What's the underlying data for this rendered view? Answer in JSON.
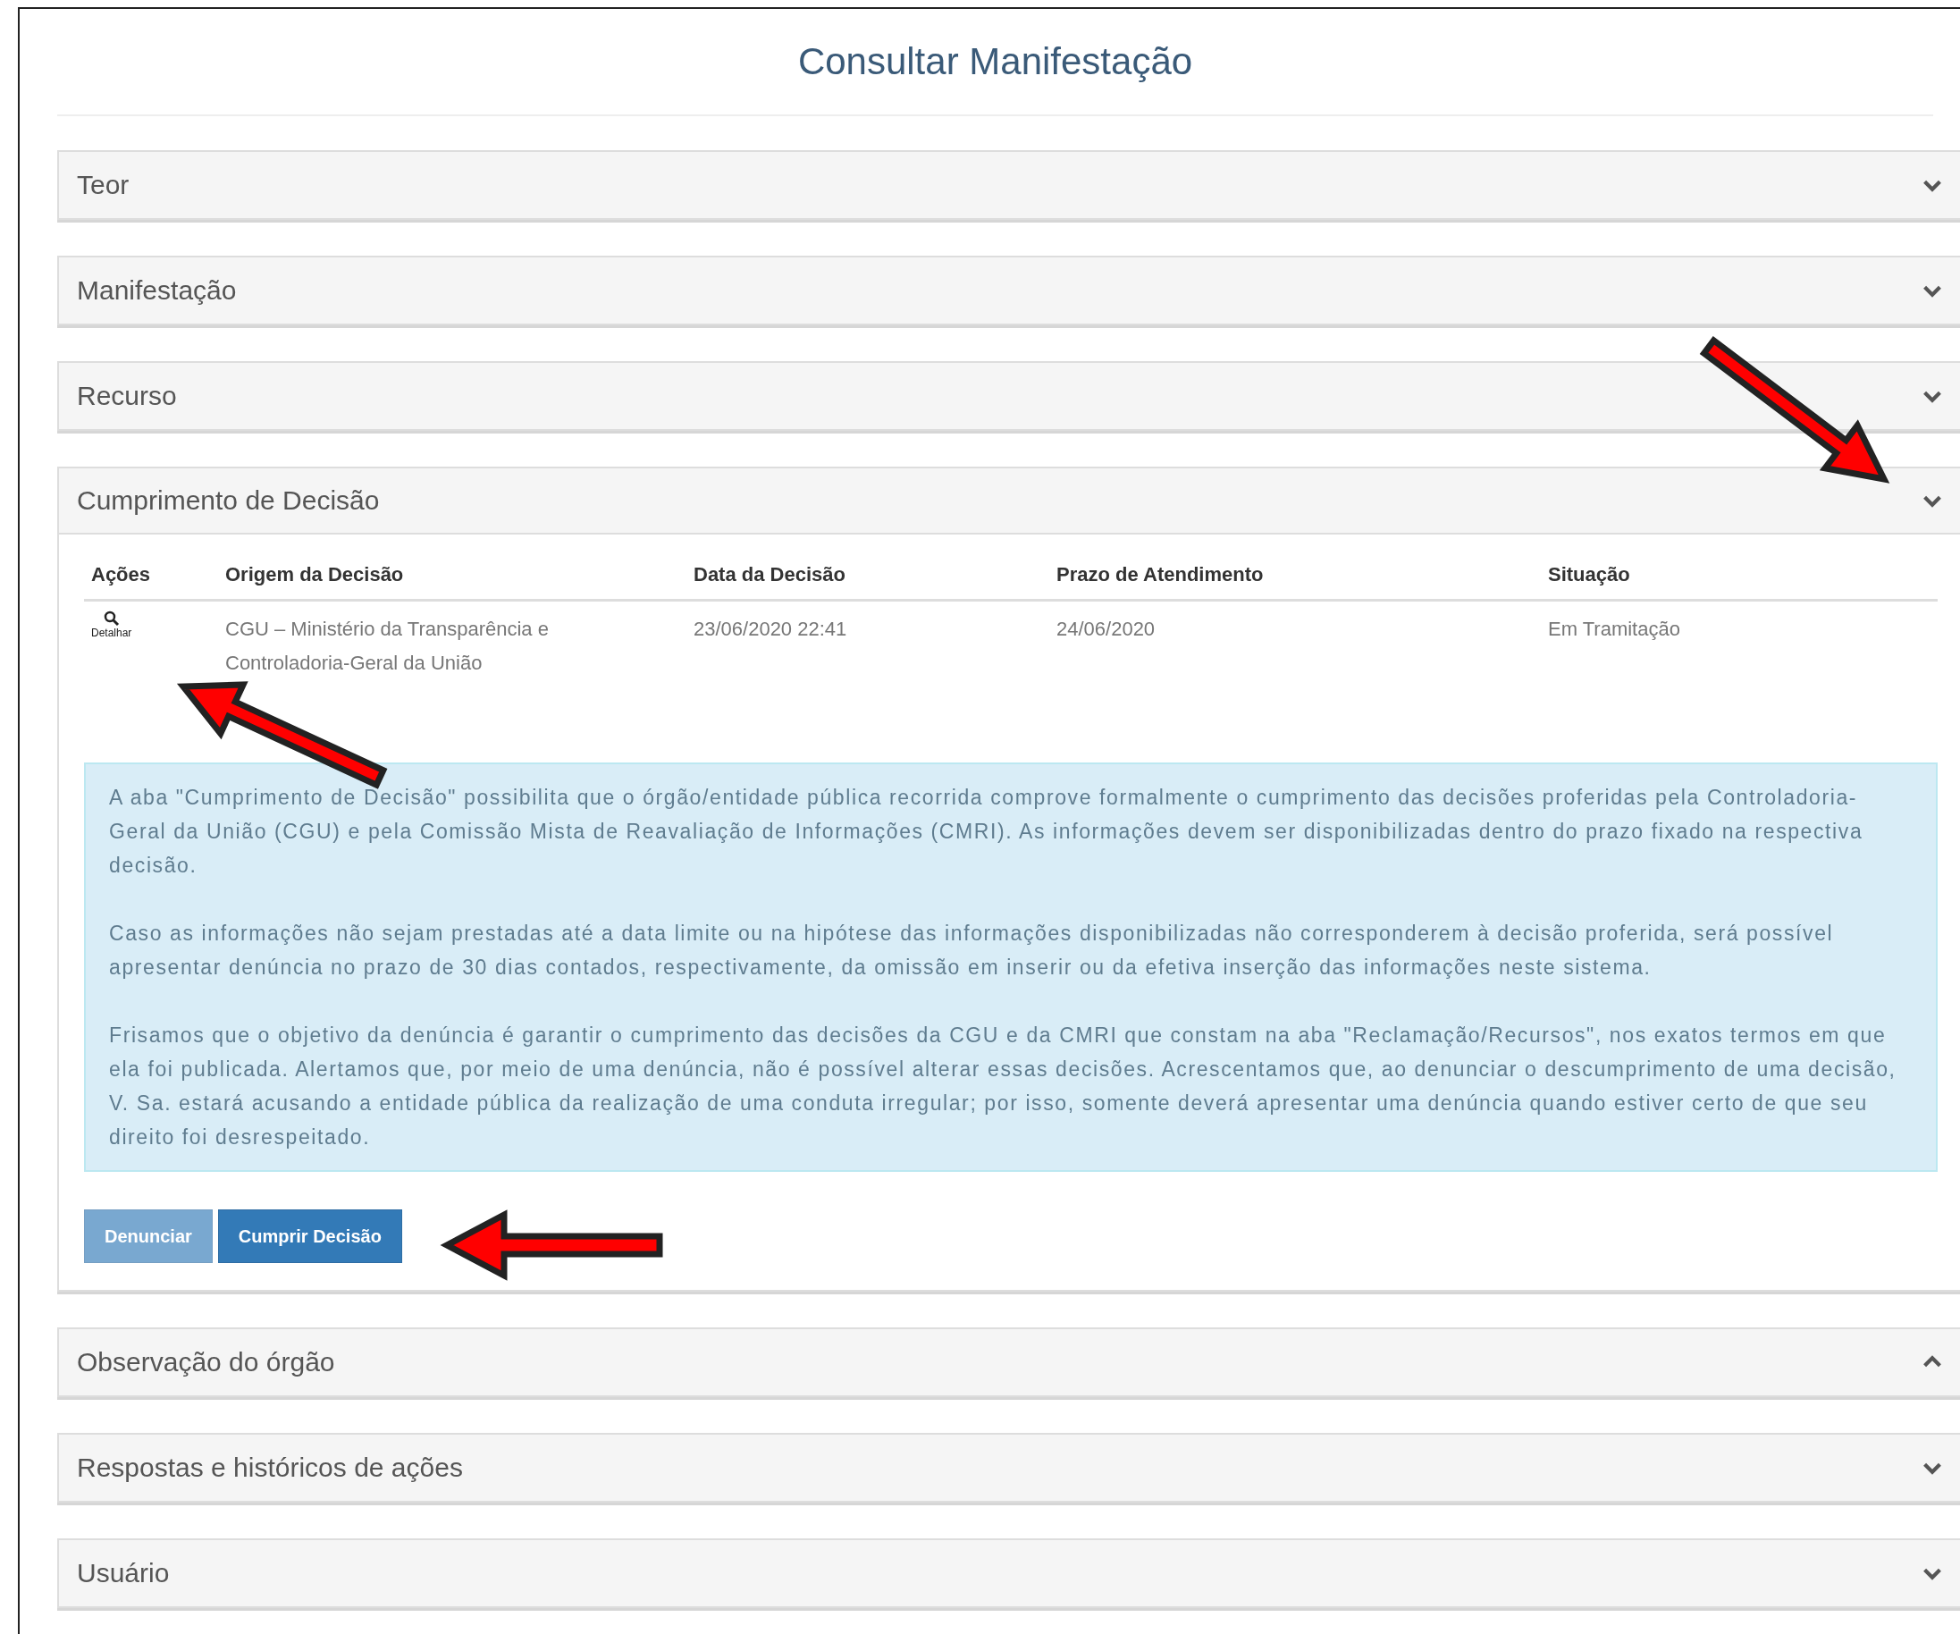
{
  "title": "Consultar Manifestação",
  "panels": [
    {
      "title": "Teor",
      "expanded": false,
      "chevron_up": false
    },
    {
      "title": "Manifestação",
      "expanded": false,
      "chevron_up": false
    },
    {
      "title": "Recurso",
      "expanded": false,
      "chevron_up": false
    },
    {
      "title": "Cumprimento de Decisão",
      "expanded": true,
      "chevron_up": false,
      "table": {
        "columns": [
          "Ações",
          "Origem da Decisão",
          "Data da Decisão",
          "Prazo de Atendimento",
          "Situação"
        ],
        "rows": [
          {
            "cells": [
              "Detalhar",
              "CGU – Ministério da Transparência e Controladoria-Geral da União",
              "23/06/2020 22:41",
              "24/06/2020",
              "Em Tramitação"
            ]
          }
        ]
      },
      "notice": [
        "A aba \"Cumprimento de Decisão\" possibilita que o órgão/entidade pública recorrida comprove formalmente o cumprimento das decisões proferidas pela Controladoria-Geral da União (CGU) e pela Comissão Mista de Reavaliação de Informações (CMRI). As informações devem ser disponibilizadas dentro do prazo fixado na respectiva decisão.",
        "Caso as informações não sejam prestadas até a data limite ou na hipótese das informações disponibilizadas não corresponderem à decisão proferida, será possível apresentar denúncia no prazo de 30 dias contados, respectivamente, da omissão em inserir ou da efetiva inserção das informações neste sistema.",
        "Frisamos que o objetivo da denúncia é garantir o cumprimento das decisões da CGU e da CMRI que constam na aba \"Reclamação/Recursos\", nos exatos termos em que ela foi publicada. Alertamos que, por meio de uma denúncia, não é possível alterar essas decisões. Acrescentamos que, ao denunciar o descumprimento de uma decisão, V. Sa. estará acusando a entidade pública da realização de uma conduta irregular; por isso, somente deverá apresentar uma denúncia quando estiver certo de que seu direito foi desrespeitado."
      ],
      "buttons": [
        {
          "label": "Denunciar",
          "disabled": true
        },
        {
          "label": "Cumprir Decisão",
          "disabled": false
        }
      ]
    },
    {
      "title": "Observação do órgão",
      "expanded": false,
      "chevron_up": true
    },
    {
      "title": "Respostas e históricos de ações",
      "expanded": false,
      "chevron_up": false
    },
    {
      "title": "Usuário",
      "expanded": false,
      "chevron_up": false
    }
  ]
}
